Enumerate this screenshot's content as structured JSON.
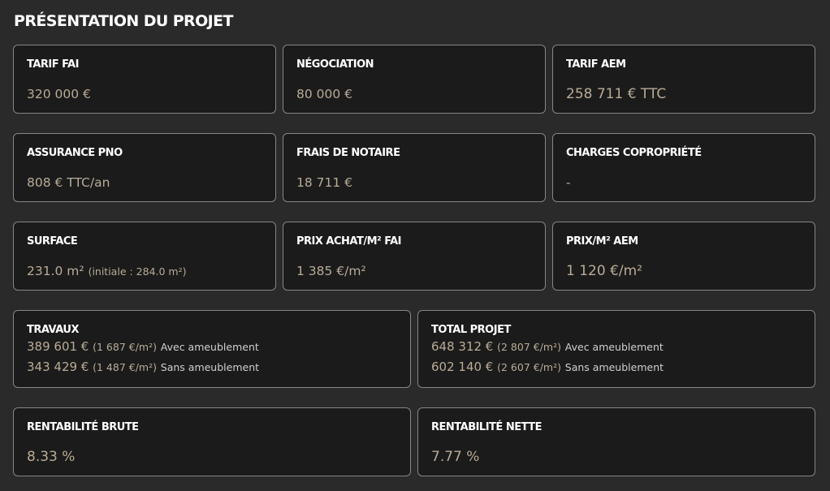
{
  "title": "PRÉSENTATION DU PROJET",
  "row1": [
    {
      "label": "TARIF FAI",
      "value": "320 000 €"
    },
    {
      "label": "NÉGOCIATION",
      "value": "80 000 €"
    },
    {
      "label": "TARIF AEM",
      "value": "258 711 € TTC"
    }
  ],
  "row2": [
    {
      "label": "ASSURANCE PNO",
      "value": "808 € TTC/an"
    },
    {
      "label": "FRAIS DE NOTAIRE",
      "value": "18 711 €"
    },
    {
      "label": "CHARGES COPROPRIÉTÉ",
      "value": "-"
    }
  ],
  "row3": [
    {
      "label": "SURFACE",
      "value": "231.0 m²",
      "note": "(initiale : 284.0 m²)"
    },
    {
      "label": "PRIX ACHAT/M² FAI",
      "value": "1 385 €/m²"
    },
    {
      "label": "PRIX/M² AEM",
      "value": "1 120 €/m²"
    }
  ],
  "travaux": {
    "label": "TRAVAUX",
    "lines": [
      {
        "amount": "389 601 €",
        "per_m2": "(1 687 €/m²)",
        "desc": "Avec ameublement"
      },
      {
        "amount": "343 429 €",
        "per_m2": "(1 487 €/m²)",
        "desc": "Sans ameublement"
      }
    ]
  },
  "total": {
    "label": "TOTAL PROJET",
    "lines": [
      {
        "amount": "648 312 €",
        "per_m2": "(2 807 €/m²)",
        "desc": "Avec ameublement"
      },
      {
        "amount": "602 140 €",
        "per_m2": "(2 607 €/m²)",
        "desc": "Sans ameublement"
      }
    ]
  },
  "rentabilite": [
    {
      "label": "RENTABILITÉ BRUTE",
      "value": "8.33 %"
    },
    {
      "label": "RENTABILITÉ NETTE",
      "value": "7.77 %"
    }
  ],
  "colors": {
    "background": "#2a2a2a",
    "card": "#1b1b1b",
    "border": "#8a8580",
    "value_text": "#b9ab97",
    "label_text": "#ffffff"
  }
}
